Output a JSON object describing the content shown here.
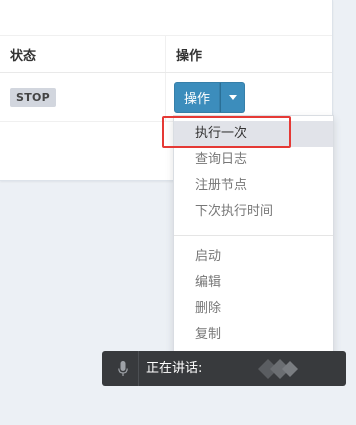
{
  "table": {
    "headers": {
      "status": "状态",
      "action": "操作"
    },
    "row": {
      "status_badge": "STOP",
      "action_button": "操作"
    }
  },
  "dropdown": {
    "items": [
      "执行一次",
      "查询日志",
      "注册节点",
      "下次执行时间",
      "启动",
      "编辑",
      "删除",
      "复制"
    ],
    "active_index": 0
  },
  "voice_bar": {
    "label": "正在讲话:"
  },
  "colors": {
    "primary_button": "#3c8dbc",
    "highlight_border": "#e53935",
    "voice_bar_bg": "#383a3d"
  }
}
